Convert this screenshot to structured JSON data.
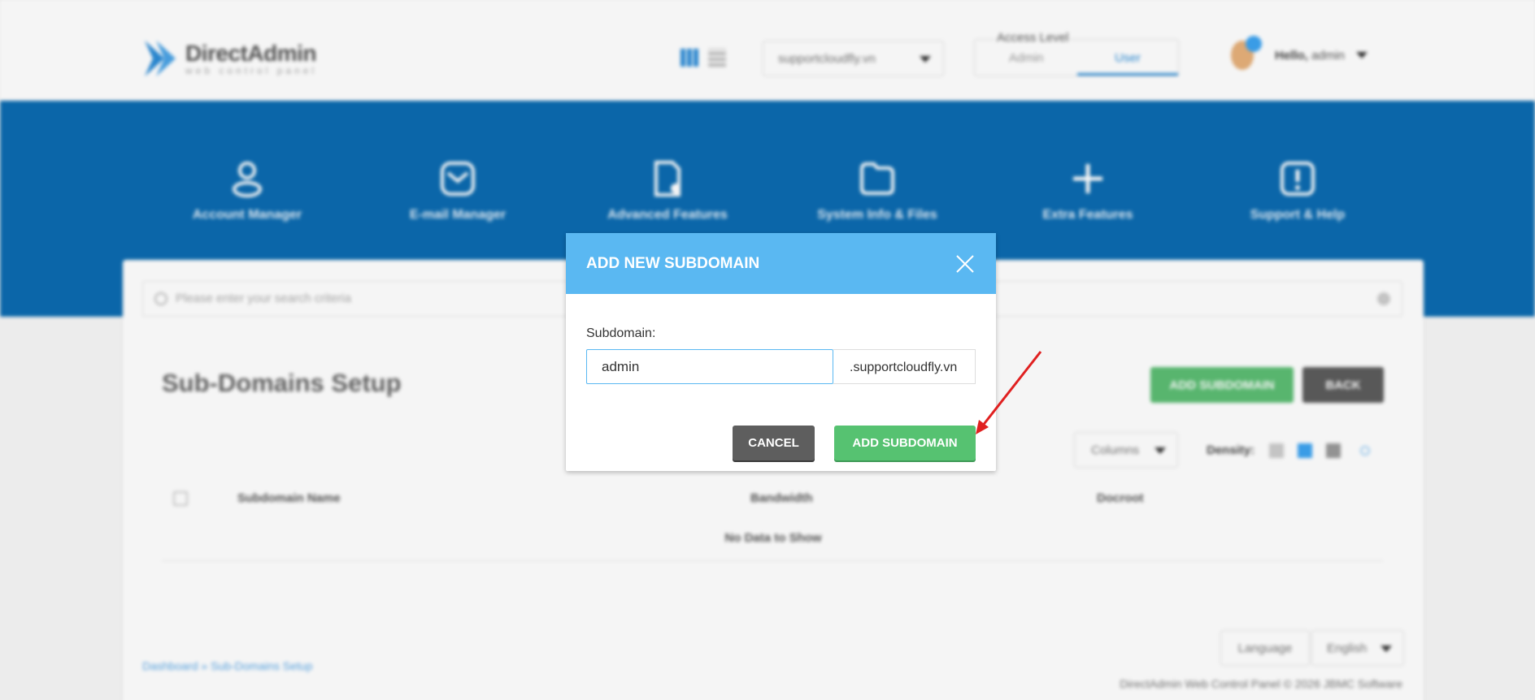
{
  "app": {
    "name": "DirectAdmin",
    "tagline": "web control panel"
  },
  "header": {
    "domain_selector": "supportcloudfly.vn",
    "access_level": {
      "label": "Access Level",
      "options": [
        "Admin",
        "User"
      ],
      "selected": "User"
    },
    "user": {
      "greeting_bold": "Hello,",
      "name": "admin"
    }
  },
  "nav": {
    "items": [
      {
        "label": "Account Manager",
        "icon": "user-icon"
      },
      {
        "label": "E-mail Manager",
        "icon": "mail-icon"
      },
      {
        "label": "Advanced Features",
        "icon": "document-gear-icon"
      },
      {
        "label": "System Info & Files",
        "icon": "folder-icon"
      },
      {
        "label": "Extra Features",
        "icon": "plus-icon"
      },
      {
        "label": "Support & Help",
        "icon": "alert-icon"
      }
    ]
  },
  "search": {
    "placeholder": "Please enter your search criteria"
  },
  "page": {
    "title": "Sub-Domains Setup",
    "add_button": "ADD SUBDOMAIN",
    "back_button": "BACK",
    "columns_button": "Columns",
    "density_label": "Density:",
    "table": {
      "headers": [
        "Subdomain Name",
        "Bandwidth",
        "Docroot"
      ],
      "empty_text": "No Data to Show"
    },
    "language_label": "Language",
    "language_value": "English",
    "breadcrumb": [
      "Dashboard",
      "Sub-Domains Setup"
    ],
    "breadcrumb_sep": "»",
    "footer": "DirectAdmin Web Control Panel © 2026 JBMC Software"
  },
  "modal": {
    "title": "ADD NEW SUBDOMAIN",
    "field_label": "Subdomain:",
    "subdomain_value": "admin",
    "suffix": ".supportcloudfly.vn",
    "cancel_button": "CANCEL",
    "submit_button": "ADD SUBDOMAIN"
  },
  "colors": {
    "brand_blue": "#0c6bb0",
    "modal_header": "#5ab8f2",
    "success_green": "#56c271",
    "cancel_gray": "#5e5e5e",
    "annotation_arrow": "#e02020"
  }
}
